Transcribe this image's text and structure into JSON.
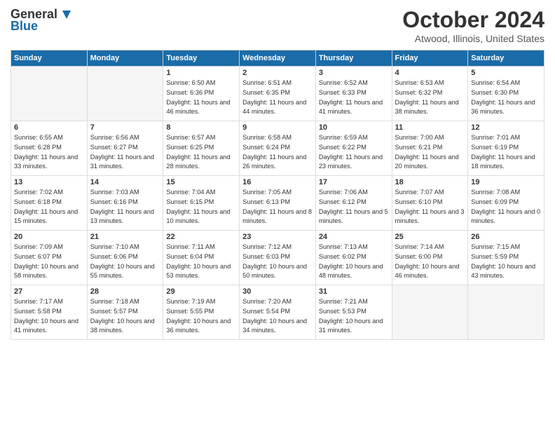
{
  "header": {
    "logo_general": "General",
    "logo_blue": "Blue",
    "title": "October 2024",
    "location": "Atwood, Illinois, United States"
  },
  "days_of_week": [
    "Sunday",
    "Monday",
    "Tuesday",
    "Wednesday",
    "Thursday",
    "Friday",
    "Saturday"
  ],
  "weeks": [
    [
      {
        "day": "",
        "sunrise": "",
        "sunset": "",
        "daylight": "",
        "empty": true
      },
      {
        "day": "",
        "sunrise": "",
        "sunset": "",
        "daylight": "",
        "empty": true
      },
      {
        "day": "1",
        "sunrise": "Sunrise: 6:50 AM",
        "sunset": "Sunset: 6:36 PM",
        "daylight": "Daylight: 11 hours and 46 minutes.",
        "empty": false
      },
      {
        "day": "2",
        "sunrise": "Sunrise: 6:51 AM",
        "sunset": "Sunset: 6:35 PM",
        "daylight": "Daylight: 11 hours and 44 minutes.",
        "empty": false
      },
      {
        "day": "3",
        "sunrise": "Sunrise: 6:52 AM",
        "sunset": "Sunset: 6:33 PM",
        "daylight": "Daylight: 11 hours and 41 minutes.",
        "empty": false
      },
      {
        "day": "4",
        "sunrise": "Sunrise: 6:53 AM",
        "sunset": "Sunset: 6:32 PM",
        "daylight": "Daylight: 11 hours and 38 minutes.",
        "empty": false
      },
      {
        "day": "5",
        "sunrise": "Sunrise: 6:54 AM",
        "sunset": "Sunset: 6:30 PM",
        "daylight": "Daylight: 11 hours and 36 minutes.",
        "empty": false
      }
    ],
    [
      {
        "day": "6",
        "sunrise": "Sunrise: 6:55 AM",
        "sunset": "Sunset: 6:28 PM",
        "daylight": "Daylight: 11 hours and 33 minutes.",
        "empty": false
      },
      {
        "day": "7",
        "sunrise": "Sunrise: 6:56 AM",
        "sunset": "Sunset: 6:27 PM",
        "daylight": "Daylight: 11 hours and 31 minutes.",
        "empty": false
      },
      {
        "day": "8",
        "sunrise": "Sunrise: 6:57 AM",
        "sunset": "Sunset: 6:25 PM",
        "daylight": "Daylight: 11 hours and 28 minutes.",
        "empty": false
      },
      {
        "day": "9",
        "sunrise": "Sunrise: 6:58 AM",
        "sunset": "Sunset: 6:24 PM",
        "daylight": "Daylight: 11 hours and 26 minutes.",
        "empty": false
      },
      {
        "day": "10",
        "sunrise": "Sunrise: 6:59 AM",
        "sunset": "Sunset: 6:22 PM",
        "daylight": "Daylight: 11 hours and 23 minutes.",
        "empty": false
      },
      {
        "day": "11",
        "sunrise": "Sunrise: 7:00 AM",
        "sunset": "Sunset: 6:21 PM",
        "daylight": "Daylight: 11 hours and 20 minutes.",
        "empty": false
      },
      {
        "day": "12",
        "sunrise": "Sunrise: 7:01 AM",
        "sunset": "Sunset: 6:19 PM",
        "daylight": "Daylight: 11 hours and 18 minutes.",
        "empty": false
      }
    ],
    [
      {
        "day": "13",
        "sunrise": "Sunrise: 7:02 AM",
        "sunset": "Sunset: 6:18 PM",
        "daylight": "Daylight: 11 hours and 15 minutes.",
        "empty": false
      },
      {
        "day": "14",
        "sunrise": "Sunrise: 7:03 AM",
        "sunset": "Sunset: 6:16 PM",
        "daylight": "Daylight: 11 hours and 13 minutes.",
        "empty": false
      },
      {
        "day": "15",
        "sunrise": "Sunrise: 7:04 AM",
        "sunset": "Sunset: 6:15 PM",
        "daylight": "Daylight: 11 hours and 10 minutes.",
        "empty": false
      },
      {
        "day": "16",
        "sunrise": "Sunrise: 7:05 AM",
        "sunset": "Sunset: 6:13 PM",
        "daylight": "Daylight: 11 hours and 8 minutes.",
        "empty": false
      },
      {
        "day": "17",
        "sunrise": "Sunrise: 7:06 AM",
        "sunset": "Sunset: 6:12 PM",
        "daylight": "Daylight: 11 hours and 5 minutes.",
        "empty": false
      },
      {
        "day": "18",
        "sunrise": "Sunrise: 7:07 AM",
        "sunset": "Sunset: 6:10 PM",
        "daylight": "Daylight: 11 hours and 3 minutes.",
        "empty": false
      },
      {
        "day": "19",
        "sunrise": "Sunrise: 7:08 AM",
        "sunset": "Sunset: 6:09 PM",
        "daylight": "Daylight: 11 hours and 0 minutes.",
        "empty": false
      }
    ],
    [
      {
        "day": "20",
        "sunrise": "Sunrise: 7:09 AM",
        "sunset": "Sunset: 6:07 PM",
        "daylight": "Daylight: 10 hours and 58 minutes.",
        "empty": false
      },
      {
        "day": "21",
        "sunrise": "Sunrise: 7:10 AM",
        "sunset": "Sunset: 6:06 PM",
        "daylight": "Daylight: 10 hours and 55 minutes.",
        "empty": false
      },
      {
        "day": "22",
        "sunrise": "Sunrise: 7:11 AM",
        "sunset": "Sunset: 6:04 PM",
        "daylight": "Daylight: 10 hours and 53 minutes.",
        "empty": false
      },
      {
        "day": "23",
        "sunrise": "Sunrise: 7:12 AM",
        "sunset": "Sunset: 6:03 PM",
        "daylight": "Daylight: 10 hours and 50 minutes.",
        "empty": false
      },
      {
        "day": "24",
        "sunrise": "Sunrise: 7:13 AM",
        "sunset": "Sunset: 6:02 PM",
        "daylight": "Daylight: 10 hours and 48 minutes.",
        "empty": false
      },
      {
        "day": "25",
        "sunrise": "Sunrise: 7:14 AM",
        "sunset": "Sunset: 6:00 PM",
        "daylight": "Daylight: 10 hours and 46 minutes.",
        "empty": false
      },
      {
        "day": "26",
        "sunrise": "Sunrise: 7:15 AM",
        "sunset": "Sunset: 5:59 PM",
        "daylight": "Daylight: 10 hours and 43 minutes.",
        "empty": false
      }
    ],
    [
      {
        "day": "27",
        "sunrise": "Sunrise: 7:17 AM",
        "sunset": "Sunset: 5:58 PM",
        "daylight": "Daylight: 10 hours and 41 minutes.",
        "empty": false
      },
      {
        "day": "28",
        "sunrise": "Sunrise: 7:18 AM",
        "sunset": "Sunset: 5:57 PM",
        "daylight": "Daylight: 10 hours and 38 minutes.",
        "empty": false
      },
      {
        "day": "29",
        "sunrise": "Sunrise: 7:19 AM",
        "sunset": "Sunset: 5:55 PM",
        "daylight": "Daylight: 10 hours and 36 minutes.",
        "empty": false
      },
      {
        "day": "30",
        "sunrise": "Sunrise: 7:20 AM",
        "sunset": "Sunset: 5:54 PM",
        "daylight": "Daylight: 10 hours and 34 minutes.",
        "empty": false
      },
      {
        "day": "31",
        "sunrise": "Sunrise: 7:21 AM",
        "sunset": "Sunset: 5:53 PM",
        "daylight": "Daylight: 10 hours and 31 minutes.",
        "empty": false
      },
      {
        "day": "",
        "sunrise": "",
        "sunset": "",
        "daylight": "",
        "empty": true
      },
      {
        "day": "",
        "sunrise": "",
        "sunset": "",
        "daylight": "",
        "empty": true
      }
    ]
  ]
}
